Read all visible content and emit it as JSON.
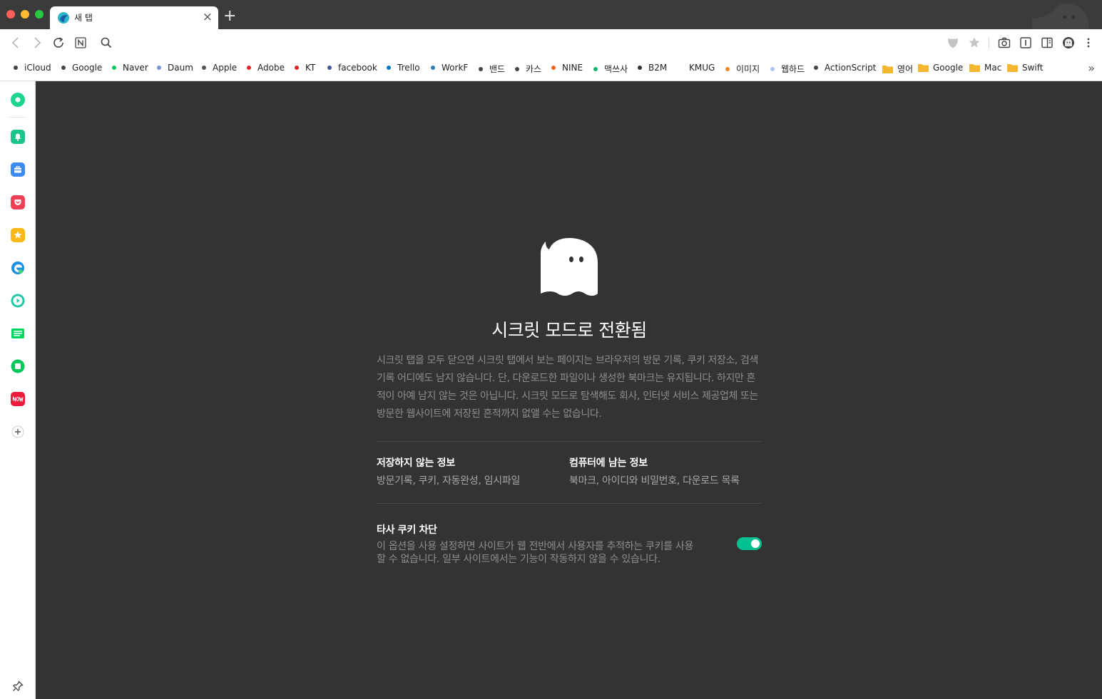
{
  "tab": {
    "title": "새 탭",
    "close": "×"
  },
  "newtab": "+",
  "bookmarks": [
    {
      "label": "iCloud",
      "color": "#444444"
    },
    {
      "label": "Google",
      "color": "#444444"
    },
    {
      "label": "Naver",
      "color": "#03c75a"
    },
    {
      "label": "Daum",
      "color": "#7b93d8"
    },
    {
      "label": "Apple",
      "color": "#555555"
    },
    {
      "label": "Adobe",
      "color": "#e3262e"
    },
    {
      "label": "KT",
      "color": "#e3262e"
    },
    {
      "label": "facebook",
      "color": "#3b5998"
    },
    {
      "label": "Trello",
      "color": "#0079bf"
    },
    {
      "label": "WorkF",
      "color": "#2f7db8"
    },
    {
      "label": "밴드",
      "color": "#444444"
    },
    {
      "label": "카스",
      "color": "#444444"
    },
    {
      "label": "NINE",
      "color": "#f26522"
    },
    {
      "label": "맥쓰사",
      "color": "#17b36b"
    },
    {
      "label": "B2M",
      "color": "#333333"
    },
    {
      "label": "KMUG",
      "color": ""
    },
    {
      "label": "이미지",
      "color": "#f0862a"
    },
    {
      "label": "웹하드",
      "color": "#a9c6f0"
    },
    {
      "label": "ActionScript",
      "color": "#444444"
    },
    {
      "label": "영어",
      "folder": true
    },
    {
      "label": "Google",
      "folder": true
    },
    {
      "label": "Mac",
      "folder": true
    },
    {
      "label": "Swift",
      "folder": true
    }
  ],
  "bookmarks_more": "»",
  "main": {
    "title": "시크릿 모드로 전환됨",
    "description": "시크릿 탭을 모두 닫으면 시크릿 탭에서 보는 페이지는 브라우저의 방문 기록, 쿠키 저장소, 검색 기록 어디에도 남지 않습니다. 단, 다운로드한 파일이나 생성한 북마크는 유지됩니다. 하지만 흔적이 아예 남지 않는 것은 아닙니다. 시크릿 모드로 탐색해도 회사, 인터넷 서비스 제공업체 또는 방문한 웹사이트에 저장된 흔적까지 없앨 수는 없습니다.",
    "not_saved": {
      "heading": "저장하지 않는 정보",
      "value": "방문기록, 쿠키, 자동완성, 임시파일"
    },
    "kept": {
      "heading": "컴퓨터에 남는 정보",
      "value": "북마크, 아이디와 비밀번호, 다운로드 목록"
    },
    "third_party": {
      "heading": "타사 쿠키 차단",
      "description": "이 옵션을 사용 설정하면 사이트가 웹 전반에서 사용자를 추적하는 쿠키를 사용할 수 없습니다. 일부 사이트에서는 기능이 작동하지 않을 수 있습니다.",
      "enabled": true
    }
  },
  "colors": {
    "accent": "#03c090",
    "background": "#333333",
    "folder": "#f5b731"
  }
}
